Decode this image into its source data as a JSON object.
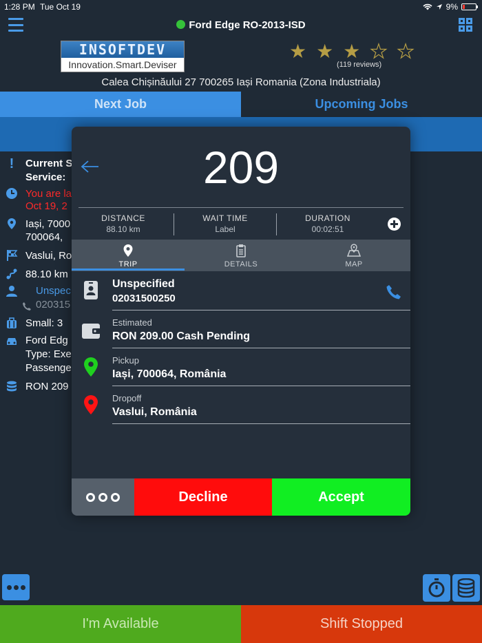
{
  "status_bar": {
    "time": "1:28 PM",
    "date": "Tue Oct 19",
    "battery": "9%"
  },
  "header": {
    "vehicle": "Ford Edge RO-2013-ISD",
    "vehicle_status_color": "#35c23a"
  },
  "company": {
    "logo_top": "INSOFTDEV",
    "logo_bottom": "Innovation.Smart.Deviser",
    "rating_stars": 3,
    "rating_max": 5,
    "reviews": "(119 reviews)",
    "address": "Calea Chișinăului 27 700265 Iași Romania (Zona Industriala)"
  },
  "tabs": {
    "next_job": "Next Job",
    "upcoming_jobs": "Upcoming Jobs"
  },
  "background_job": {
    "current_status": "Current S",
    "service": "Service:",
    "late_line1": "You are la",
    "late_line2": "Oct 19, 2",
    "pickup_line1": "Iași, 7000",
    "pickup_line2": "700064,",
    "dropoff": "Vaslui, Ro",
    "distance": "88.10 km",
    "passenger_name": "Unspec",
    "passenger_phone": "020315",
    "luggage": "Small: 3",
    "vehicle_line1": "Ford Edg",
    "vehicle_line2": "Type: Exe",
    "vehicle_line3": "Passenge",
    "price": "RON 209"
  },
  "offer": {
    "price": "209",
    "distance_label": "DISTANCE",
    "distance_value": "88.10 km",
    "wait_label": "WAIT TIME",
    "wait_value": "Label",
    "duration_label": "DURATION",
    "duration_value": "00:02:51",
    "tabs": [
      "TRIP",
      "DETAILS",
      "MAP"
    ],
    "active_tab": "TRIP",
    "passenger_name": "Unspecified",
    "passenger_phone": "02031500250",
    "payment_label": "Estimated",
    "payment_value": "RON 209.00  Cash  Pending",
    "pickup_label": "Pickup",
    "pickup_value": "Iași, 700064, România",
    "dropoff_label": "Dropoff",
    "dropoff_value": "Vaslui, România",
    "decline": "Decline",
    "accept": "Accept"
  },
  "bottom": {
    "available": "I'm Available",
    "shift": "Shift Stopped"
  },
  "colors": {
    "accent": "#3b8fe2",
    "decline": "#ff0c0c",
    "accept": "#11ee22",
    "available": "#4faa1e",
    "shift": "#d7380c"
  }
}
